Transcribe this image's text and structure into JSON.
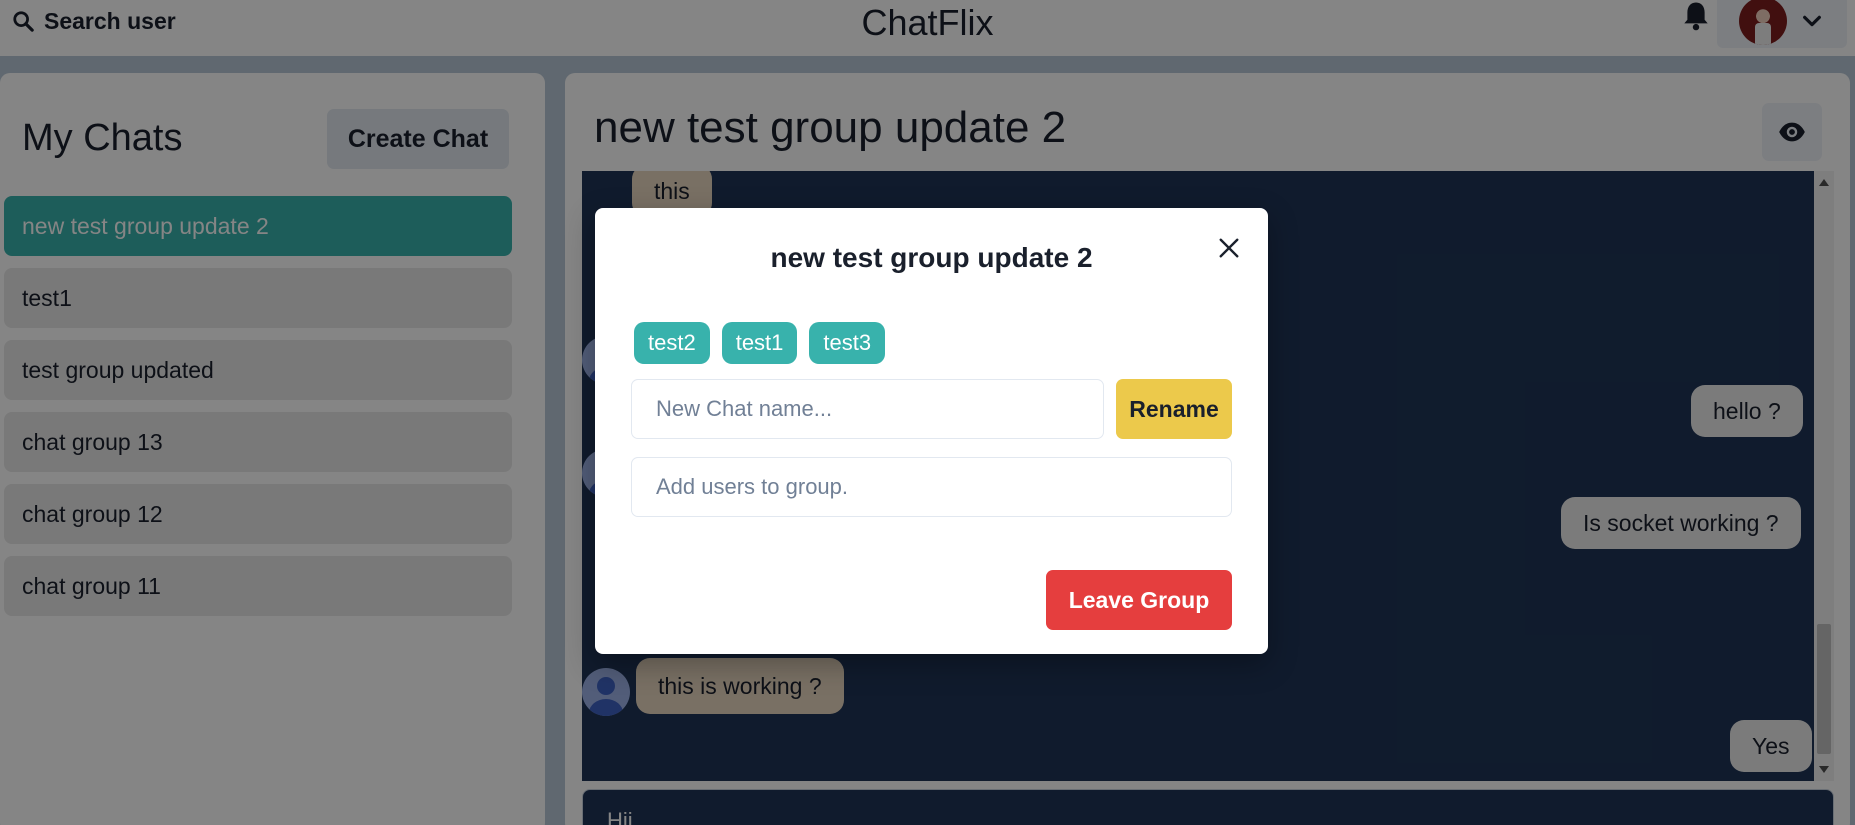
{
  "header": {
    "search_label": "Search user",
    "app_title": "ChatFlix"
  },
  "sidebar": {
    "title": "My Chats",
    "create_label": "Create Chat",
    "chats": [
      {
        "name": "new test group update 2",
        "active": true
      },
      {
        "name": "test1",
        "active": false
      },
      {
        "name": "test group updated",
        "active": false
      },
      {
        "name": "chat group 13",
        "active": false
      },
      {
        "name": "chat group 12",
        "active": false
      },
      {
        "name": "chat group 11",
        "active": false
      }
    ]
  },
  "chat": {
    "title": "new test group update 2",
    "messages": [
      {
        "text": "this",
        "from": "them"
      },
      {
        "text": "hello ?",
        "from": "me"
      },
      {
        "text": "Is socket working ?",
        "from": "me"
      },
      {
        "text": "this is working ?",
        "from": "them"
      },
      {
        "text": "Yes",
        "from": "me"
      }
    ],
    "composer_value": "Hii"
  },
  "modal": {
    "title": "new test group update 2",
    "members": [
      "test2",
      "test1",
      "test3"
    ],
    "rename_placeholder": "New Chat name...",
    "rename_label": "Rename",
    "add_placeholder": "Add users to group.",
    "leave_label": "Leave Group"
  },
  "colors": {
    "accent": "#38b2ac",
    "rename": "#ecc94b",
    "leave": "#e53e3e",
    "chat_bg": "#1f3557"
  }
}
